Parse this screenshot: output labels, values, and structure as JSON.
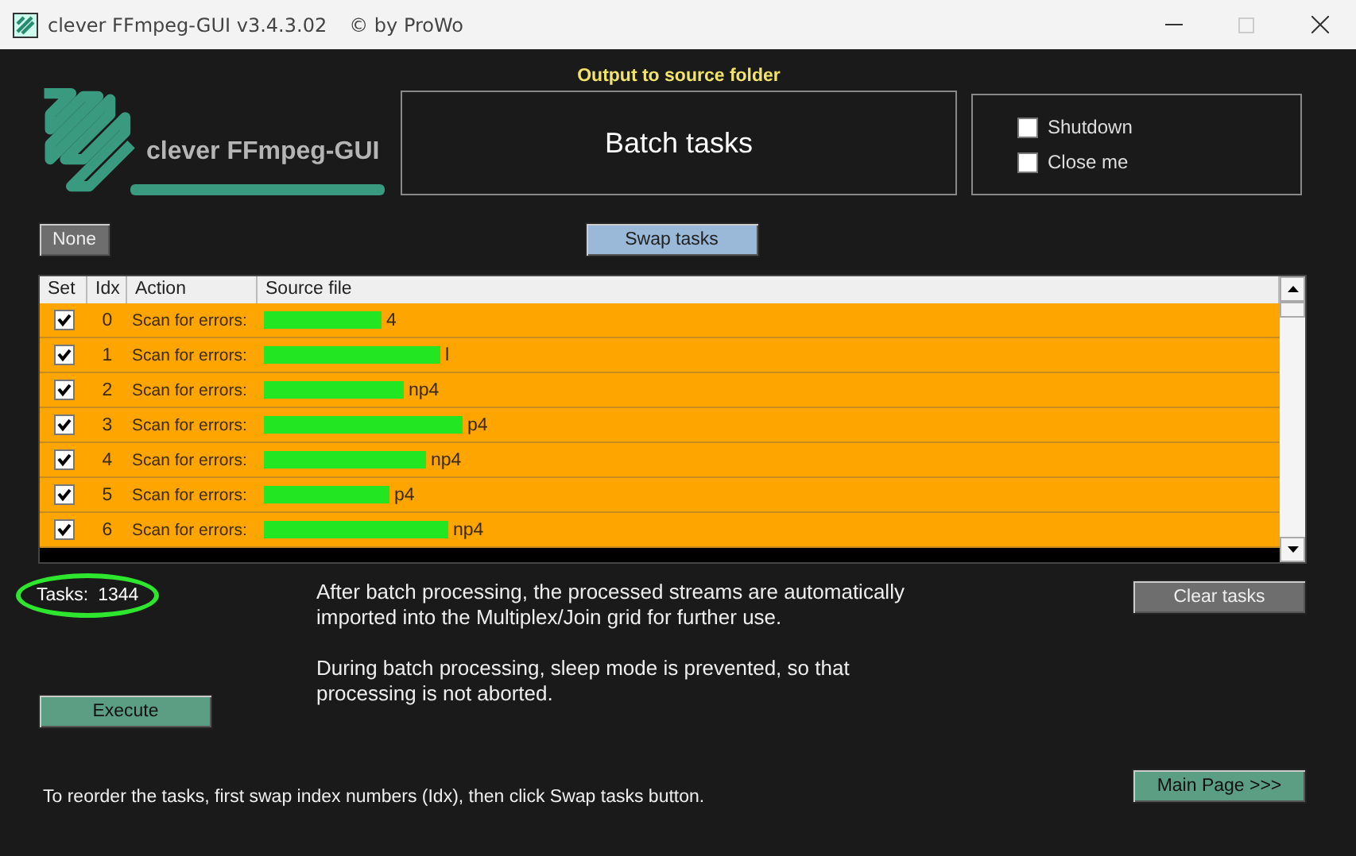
{
  "window": {
    "title": "clever FFmpeg-GUI v3.4.3.02",
    "copyright": "© by ProWo",
    "maximize_disabled": true
  },
  "logo": {
    "text": "clever FFmpeg-GUI"
  },
  "output_label": "Output to source folder",
  "page_title": "Batch tasks",
  "options": [
    {
      "label": "Shutdown",
      "checked": false
    },
    {
      "label": "Close me",
      "checked": false
    }
  ],
  "buttons": {
    "none": "None",
    "swap": "Swap tasks",
    "clear": "Clear tasks",
    "execute": "Execute",
    "main_page": "Main Page >>>"
  },
  "table": {
    "columns": [
      "Set",
      "Idx",
      "Action",
      "Source file"
    ],
    "rows": [
      {
        "checked": true,
        "idx": "0",
        "action": "Scan for errors:",
        "source": "4",
        "redacted": true
      },
      {
        "checked": true,
        "idx": "1",
        "action": "Scan for errors:",
        "source": "l",
        "redacted": true
      },
      {
        "checked": true,
        "idx": "2",
        "action": "Scan for errors:",
        "source": "np4",
        "redacted": true
      },
      {
        "checked": true,
        "idx": "3",
        "action": "Scan for errors:",
        "source": "p4",
        "redacted": true
      },
      {
        "checked": true,
        "idx": "4",
        "action": "Scan for errors:",
        "source": "np4",
        "redacted": true
      },
      {
        "checked": true,
        "idx": "5",
        "action": "Scan for errors:",
        "source": "p4",
        "redacted": true
      },
      {
        "checked": true,
        "idx": "6",
        "action": "Scan for errors:",
        "source": "np4",
        "redacted": true
      }
    ]
  },
  "tasks_count": {
    "label": "Tasks:",
    "value": "1344",
    "circled": true
  },
  "info": [
    "After batch processing, the processed streams are automatically imported into the Multiplex/Join grid for further use.",
    "During batch processing, sleep mode is prevented, so that processing is not aborted."
  ],
  "footer": "To reorder the tasks, first swap index numbers (Idx), then click Swap tasks button."
}
